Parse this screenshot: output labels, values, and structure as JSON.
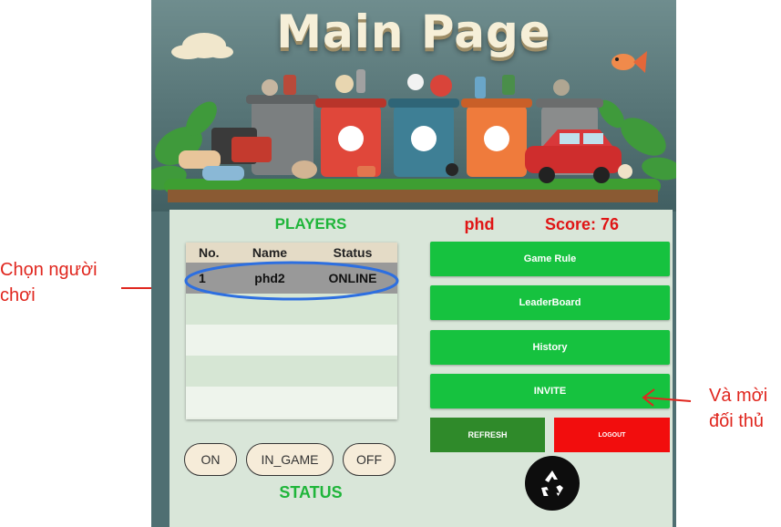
{
  "app": {
    "title": "Main Page",
    "username": "phd",
    "score_label": "Score:",
    "score_value": "76"
  },
  "players": {
    "title": "PLAYERS",
    "columns": [
      "No.",
      "Name",
      "Status"
    ],
    "rows": [
      {
        "no": "1",
        "name": "phd2",
        "status": "ONLINE"
      }
    ]
  },
  "menu": {
    "game_rule": "Game Rule",
    "leaderboard": "LeaderBoard",
    "history": "History",
    "invite": "INVITE",
    "refresh": "REFRESH",
    "logout": "LOGOUT"
  },
  "status": {
    "title": "STATUS",
    "options": [
      "ON",
      "IN_GAME",
      "OFF"
    ]
  },
  "annotations": {
    "left_line1": "Chọn người",
    "left_line2": "chơi",
    "right_line1": "Và mời",
    "right_line2": "đối thủ"
  },
  "colors": {
    "accent_green": "#16c23f",
    "score_red": "#e01515",
    "annotation_red": "#e0261e",
    "refresh_green": "#2f8a2a",
    "logout_red": "#f20d0d"
  },
  "icons": [
    "recycle-icon"
  ]
}
